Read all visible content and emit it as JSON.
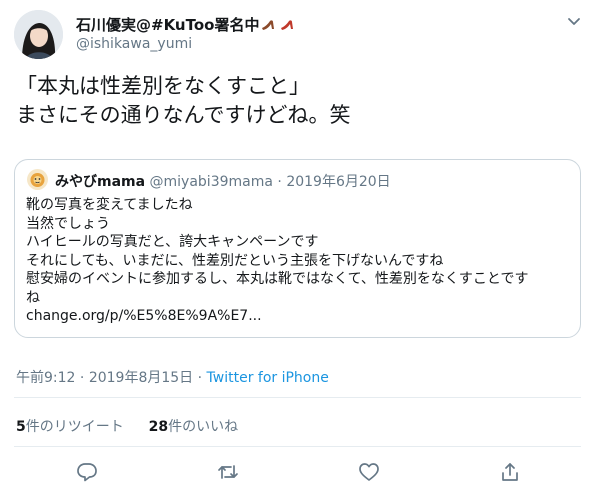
{
  "author": {
    "display_name": "石川優実@#KuToo署名中",
    "handle": "@ishikawa_yumi"
  },
  "tweet": {
    "text": "「本丸は性差別をなくすこと」\nまさにその通りなんですけどね。笑"
  },
  "quote": {
    "display_name": "みやびmama",
    "handle": "@miyabi39mama",
    "separator": "·",
    "date": "2019年6月20日",
    "text": "靴の写真を変えてましたね\n当然でしょう\nハイヒールの写真だと、誇大キャンペーンです\nそれにしても、いまだに、性差別だという主張を下げないんですね\n慰安婦のイベントに参加するし、本丸は靴ではなくて、性差別をなくすことです\nね\nchange.org/p/%E5%8E%9A%E7..."
  },
  "meta": {
    "time": "午前9:12",
    "separator": "·",
    "date": "2019年8月15日",
    "source": "Twitter for iPhone"
  },
  "stats": {
    "retweet_count": "5",
    "retweet_label": "件のリツイート",
    "like_count": "28",
    "like_label": "件のいいね"
  },
  "icons": {
    "caret": "chevron-down-icon",
    "reply": "reply-icon",
    "retweet": "retweet-icon",
    "like": "heart-icon",
    "share": "share-icon",
    "shoe": "high-heel-icon"
  },
  "colors": {
    "link": "#1b95e0",
    "secondary": "#657786",
    "border": "#ccd6dd",
    "shoe": "#c0392b"
  }
}
